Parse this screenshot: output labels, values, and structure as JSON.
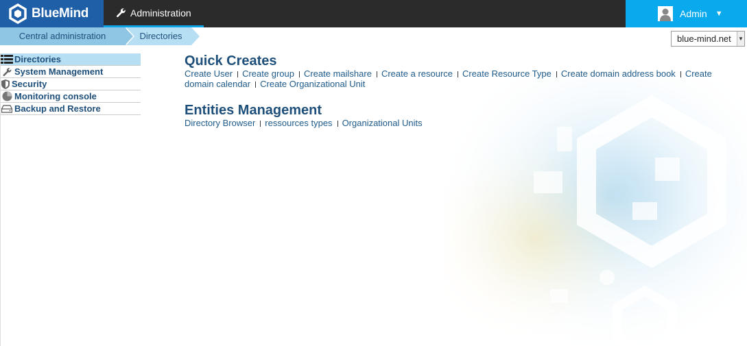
{
  "app": {
    "logo_text": "BlueMind",
    "section_tab": "Administration",
    "user_name": "Admin",
    "user_caret": "▼"
  },
  "breadcrumb": [
    "Central administration",
    "Directories"
  ],
  "domain_select": {
    "value": "blue-mind.net"
  },
  "sidebar": {
    "items": [
      {
        "label": "Directories",
        "icon": "list-icon",
        "active": true
      },
      {
        "label": "System Management",
        "icon": "wrench-icon",
        "active": false
      },
      {
        "label": "Security",
        "icon": "shield-icon",
        "active": false
      },
      {
        "label": "Monitoring console",
        "icon": "pie-chart-icon",
        "active": false
      },
      {
        "label": "Backup and Restore",
        "icon": "drive-icon",
        "active": false
      }
    ]
  },
  "quick_creates": {
    "title": "Quick Creates",
    "links": [
      "Create User",
      "Create group",
      "Create mailshare",
      "Create a resource",
      "Create Resource Type",
      "Create domain address book",
      "Create domain calendar",
      "Create Organizational Unit"
    ]
  },
  "entities": {
    "title": "Entities Management",
    "links": [
      "Directory Browser",
      "ressources types",
      "Organizational Units"
    ]
  },
  "colors": {
    "topbar": "#2b2b2b",
    "logo_bg": "#1e5fa8",
    "user_bg": "#09a9ee",
    "link": "#1e5a8a",
    "title": "#1e4f7a",
    "active_nav": "#b7dff3"
  }
}
